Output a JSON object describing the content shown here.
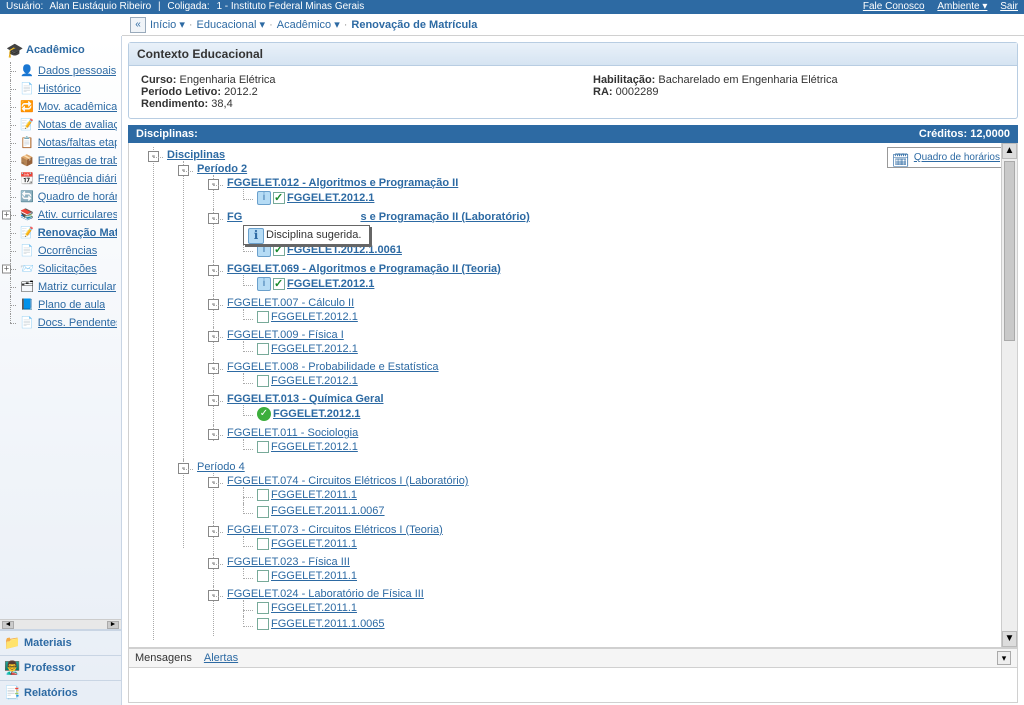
{
  "topbar": {
    "user_label": "Usuário:",
    "user_name": "Alan Eustáquio Ribeiro",
    "sep": "|",
    "coligada_label": "Coligada:",
    "coligada_value": "1 - Instituto Federal Minas Gerais",
    "fale_conosco": "Fale Conosco",
    "ambiente": "Ambiente ▾",
    "sair": "Sair"
  },
  "breadcrumb": {
    "prev_icon": "«",
    "inicio": "Início ▾",
    "educacional": "Educacional ▾",
    "academico": "Acadêmico ▾",
    "current": "Renovação de Matrícula"
  },
  "sidebar": {
    "academico": {
      "title": "Acadêmico",
      "items": [
        {
          "icon": "👤",
          "label": "Dados pessoais"
        },
        {
          "icon": "📄",
          "label": "Histórico"
        },
        {
          "icon": "🔁",
          "label": "Mov. acadêmica"
        },
        {
          "icon": "📝",
          "label": "Notas de avaliações"
        },
        {
          "icon": "📋",
          "label": "Notas/faltas etapas"
        },
        {
          "icon": "📦",
          "label": "Entregas de trab./a"
        },
        {
          "icon": "📆",
          "label": "Freqüência diária"
        },
        {
          "icon": "🔄",
          "label": "Quadro de horários"
        },
        {
          "icon": "📚",
          "label": "Ativ. curriculares",
          "expandable": true
        },
        {
          "icon": "📝",
          "label": "Renovação Matríc",
          "bold": true
        },
        {
          "icon": "📄",
          "label": "Ocorrências"
        },
        {
          "icon": "📨",
          "label": "Solicitações",
          "expandable": true
        },
        {
          "icon": "🗂",
          "label": "Matriz curricular"
        },
        {
          "icon": "📘",
          "label": "Plano de aula"
        },
        {
          "icon": "📄",
          "label": "Docs. Pendentes"
        }
      ]
    },
    "materiais": "Materiais",
    "professor": "Professor",
    "relatorios": "Relatórios"
  },
  "context": {
    "title": "Contexto Educacional",
    "curso_l": "Curso:",
    "curso_v": "Engenharia Elétrica",
    "periodo_l": "Período Letivo:",
    "periodo_v": "2012.2",
    "rend_l": "Rendimento:",
    "rend_v": "38,4",
    "habil_l": "Habilitação:",
    "habil_v": "Bacharelado em Engenharia Elétrica",
    "ra_l": "RA:",
    "ra_v": "0002289"
  },
  "discbar": {
    "left": "Disciplinas:",
    "right_l": "Créditos:",
    "right_v": "12,0000"
  },
  "quadro": {
    "label": "Quadro de horários"
  },
  "tooltip": {
    "text": "Disciplina sugerida."
  },
  "tree": {
    "root": "Disciplinas",
    "p2": {
      "label": "Período 2",
      "d1": {
        "label": "FGGELET.012 - Algoritmos e Programação II",
        "class1": "FGGELET.2012.1"
      },
      "d2": {
        "label": "s e Programação II (Laboratório)",
        "prefix": "FG",
        "class1": "FGGELET.2012.1.0061"
      },
      "d3": {
        "label": "FGGELET.069 - Algoritmos e Programação II (Teoria)",
        "class1": "FGGELET.2012.1"
      },
      "d4": {
        "label": "FGGELET.007 - Cálculo II",
        "class1": "FGGELET.2012.1"
      },
      "d5": {
        "label": "FGGELET.009 - Física I",
        "class1": "FGGELET.2012.1"
      },
      "d6": {
        "label": "FGGELET.008 - Probabilidade e Estatística",
        "class1": "FGGELET.2012.1"
      },
      "d7": {
        "label": "FGGELET.013 - Química Geral",
        "class1": "FGGELET.2012.1"
      },
      "d8": {
        "label": "FGGELET.011 - Sociologia",
        "class1": "FGGELET.2012.1"
      }
    },
    "p4": {
      "label": "Período 4",
      "d1": {
        "label": "FGGELET.074 - Circuitos Elétricos I (Laboratório)",
        "class1": "FGGELET.2011.1",
        "class2": "FGGELET.2011.1.0067"
      },
      "d2": {
        "label": "FGGELET.073 - Circuitos Elétricos I (Teoria)",
        "class1": "FGGELET.2011.1"
      },
      "d3": {
        "label": "FGGELET.023 - Física III",
        "class1": "FGGELET.2011.1"
      },
      "d4": {
        "label": "FGGELET.024 - Laboratório de Física III",
        "class1": "FGGELET.2011.1",
        "class2": "FGGELET.2011.1.0065"
      }
    }
  },
  "tabs": {
    "mensagens": "Mensagens",
    "alertas": "Alertas"
  }
}
